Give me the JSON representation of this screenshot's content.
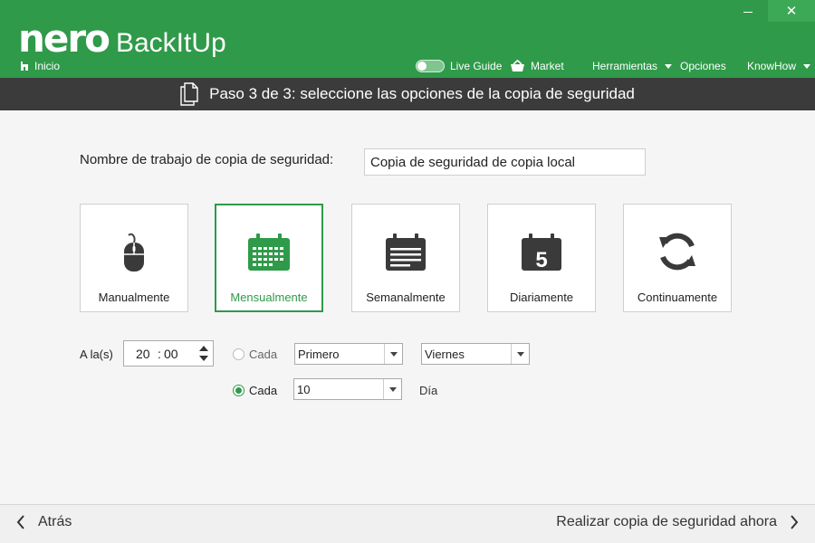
{
  "window": {
    "close_glyph": "✕"
  },
  "header": {
    "logo_nero": "nero",
    "logo_product": "BackItUp",
    "home_label": "Inicio",
    "nav": {
      "live_guide": "Live Guide",
      "market": "Market",
      "herramientas": "Herramientas",
      "opciones": "Opciones",
      "knowhow": "KnowHow"
    }
  },
  "step": {
    "title": "Paso 3 de 3: seleccione las opciones de la copia de seguridad"
  },
  "job": {
    "label": "Nombre de trabajo de copia de seguridad:",
    "value": "Copia de seguridad de copia local"
  },
  "schedule": {
    "selected": "Mensualmente",
    "options": [
      {
        "label": "Manualmente",
        "icon": "mouse-icon"
      },
      {
        "label": "Mensualmente",
        "icon": "calendar-month-icon"
      },
      {
        "label": "Semanalmente",
        "icon": "calendar-week-icon"
      },
      {
        "label": "Diariamente",
        "icon": "calendar-day-icon"
      },
      {
        "label": "Continuamente",
        "icon": "refresh-icon"
      }
    ],
    "day_icon_number": "5"
  },
  "time": {
    "label": "A la(s)",
    "hours": "20",
    "separator": ":",
    "minutes": "00"
  },
  "options": {
    "cada_label": "Cada",
    "ordinal_value": "Primero",
    "weekday_value": "Viernes",
    "day_value": "10",
    "day_unit": "Día"
  },
  "footer": {
    "back_label": "Atrás",
    "next_label": "Realizar copia de seguridad ahora"
  },
  "colors": {
    "brand_green": "#2f9a49",
    "step_bar": "#3b3b3b"
  }
}
